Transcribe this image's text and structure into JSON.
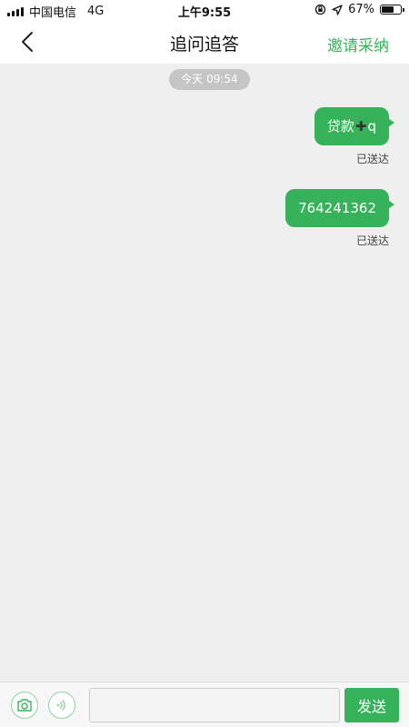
{
  "status_bar": {
    "carrier": "中国电信",
    "network": "4G",
    "time": "上午9:55",
    "battery_text": "67%",
    "battery_level": 0.67,
    "icons": [
      "signal-icon",
      "orientation-lock-icon",
      "location-icon",
      "battery-icon"
    ]
  },
  "nav": {
    "back_icon": "chevron-left-icon",
    "title": "追问追答",
    "adopt_label": "邀请采纳"
  },
  "chat": {
    "time_chip": "今天 09:54",
    "messages": [
      {
        "text_before": "贷款",
        "glyph": "✚",
        "text_after": "q",
        "status": "已送达"
      },
      {
        "text": "764241362",
        "status": "已送达"
      }
    ]
  },
  "input_bar": {
    "camera_icon": "camera-icon",
    "voice_icon": "voice-icon",
    "input_value": "",
    "input_placeholder": "",
    "send_label": "发送"
  },
  "colors": {
    "accent": "#36b35a",
    "background": "#efefef",
    "time_chip": "#c5c5c5"
  }
}
